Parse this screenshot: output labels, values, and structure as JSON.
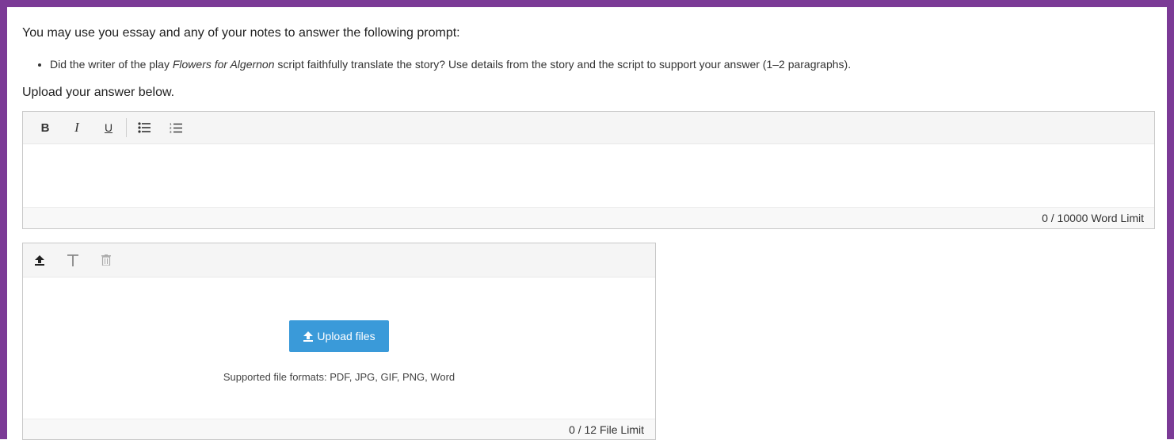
{
  "colors": {
    "frame": "#7b3a96",
    "upload_button": "#3a9ad9"
  },
  "intro": "You may use you essay and any of your notes to answer the following prompt:",
  "prompt": {
    "before": "Did the writer of the play ",
    "title": "Flowers for Algernon",
    "after": " script faithfully translate the story? Use details from the story and the script to support your answer (1–2 paragraphs)."
  },
  "upload_label": "Upload your answer below.",
  "editor": {
    "toolbar": [
      {
        "name": "bold",
        "label": "B"
      },
      {
        "name": "italic",
        "label": "I"
      },
      {
        "name": "underline",
        "label": "U"
      },
      {
        "name": "bulleted-list",
        "icon": "bulleted-list-icon"
      },
      {
        "name": "numbered-list",
        "icon": "numbered-list-icon"
      }
    ],
    "value": "",
    "word_count": "0",
    "word_limit": "/ 10000 Word Limit"
  },
  "uploader": {
    "toolbar_icons": [
      "upload-icon",
      "text-icon",
      "trash-icon"
    ],
    "button_label": "Upload files",
    "formats": "Supported file formats: PDF, JPG, GIF, PNG, Word",
    "file_limit": "0 / 12 File Limit"
  }
}
